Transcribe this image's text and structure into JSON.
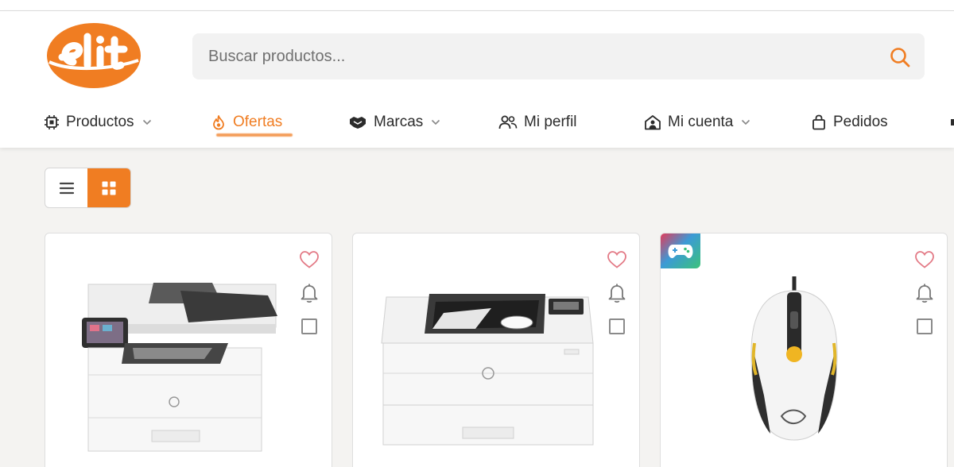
{
  "search": {
    "placeholder": "Buscar productos..."
  },
  "nav": {
    "items": [
      {
        "label": "Productos",
        "icon": "cpu-icon",
        "has_dropdown": true
      },
      {
        "label": "Ofertas",
        "icon": "flame-icon",
        "active": true
      },
      {
        "label": "Marcas",
        "icon": "handshake-icon",
        "has_dropdown": true
      },
      {
        "label": "Mi perfil",
        "icon": "users-icon"
      },
      {
        "label": "Mi cuenta",
        "icon": "home-user-icon",
        "has_dropdown": true
      },
      {
        "label": "Pedidos",
        "icon": "shopping-bag-icon"
      }
    ]
  },
  "view_toggle": {
    "active": "grid",
    "options": [
      "list-icon",
      "grid-icon"
    ]
  },
  "products": [
    {
      "image": "multifunction-printer",
      "badge": null
    },
    {
      "image": "laser-printer",
      "badge": null
    },
    {
      "image": "gaming-mouse",
      "badge": "gamepad-icon"
    }
  ],
  "colors": {
    "accent": "#f07d22",
    "heart": "#e37a86",
    "background": "#f4f3f1"
  }
}
